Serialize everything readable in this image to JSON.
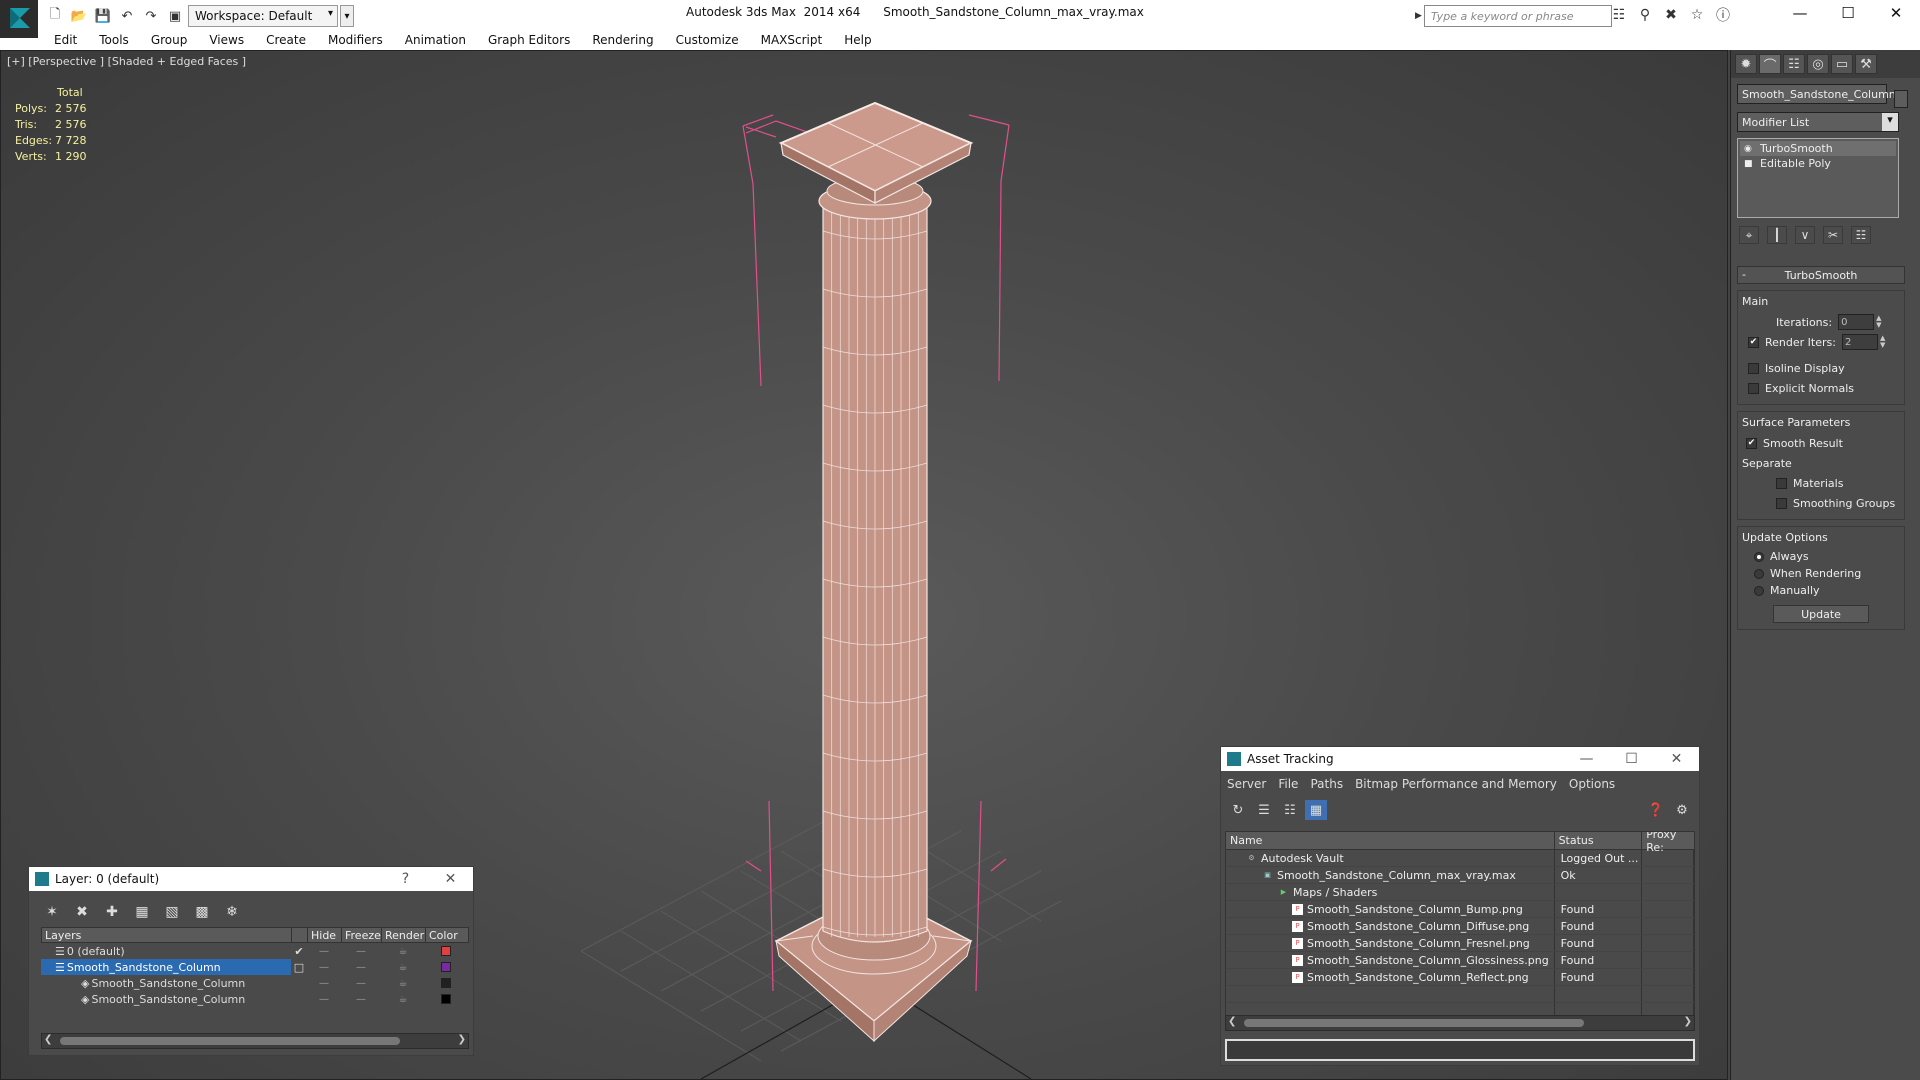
{
  "app": {
    "title": "Autodesk 3ds Max  2014 x64      Smooth_Sandstone_Column_max_vray.max",
    "workspace": "Workspace: Default",
    "search_placeholder": "Type a keyword or phrase"
  },
  "menu": [
    "Edit",
    "Tools",
    "Group",
    "Views",
    "Create",
    "Modifiers",
    "Animation",
    "Graph Editors",
    "Rendering",
    "Customize",
    "MAXScript",
    "Help"
  ],
  "viewport": {
    "label": "[+] [Perspective ] [Shaded + Edged Faces ]",
    "stats": {
      "total_label": "Total",
      "rows": [
        {
          "k": "Polys:",
          "v": "2 576"
        },
        {
          "k": "Tris:",
          "v": "2 576"
        },
        {
          "k": "Edges:",
          "v": "7 728"
        },
        {
          "k": "Verts:",
          "v": "1 290"
        }
      ]
    }
  },
  "command_panel": {
    "object_name": "Smooth_Sandstone_Column",
    "modifier_list": "Modifier List",
    "stack": [
      "TurboSmooth",
      "Editable Poly"
    ],
    "rollout": "TurboSmooth",
    "main_group": "Main",
    "iterations_label": "Iterations:",
    "iterations_value": "0",
    "render_iters_label": "Render Iters:",
    "render_iters_value": "2",
    "isoline": "Isoline Display",
    "explicit": "Explicit Normals",
    "surface_group": "Surface Parameters",
    "smooth_result": "Smooth Result",
    "separate": "Separate",
    "materials": "Materials",
    "smoothing_groups": "Smoothing Groups",
    "update_group": "Update Options",
    "always": "Always",
    "when_rendering": "When Rendering",
    "manually": "Manually",
    "update_btn": "Update"
  },
  "layer_window": {
    "title": "Layer: 0 (default)",
    "help": "?",
    "headers": [
      "Layers",
      "Hide",
      "Freeze",
      "Render",
      "Color"
    ],
    "rows": [
      {
        "name": "0 (default)",
        "color": "#e04040"
      },
      {
        "name": "Smooth_Sandstone_Column",
        "color": "#7a2aa0"
      },
      {
        "name": "Smooth_Sandstone_Column",
        "color": "#202020"
      },
      {
        "name": "Smooth_Sandstone_Column",
        "color": "#000000"
      }
    ]
  },
  "asset_window": {
    "title": "Asset Tracking",
    "menu": [
      "Server",
      "File",
      "Paths",
      "Bitmap Performance and Memory",
      "Options"
    ],
    "headers": [
      "Name",
      "Status",
      "Proxy Re:"
    ],
    "rows": [
      {
        "name": "Autodesk Vault",
        "status": "Logged Out ..."
      },
      {
        "name": "Smooth_Sandstone_Column_max_vray.max",
        "status": "Ok"
      },
      {
        "name": "Maps / Shaders",
        "status": ""
      },
      {
        "name": "Smooth_Sandstone_Column_Bump.png",
        "status": "Found"
      },
      {
        "name": "Smooth_Sandstone_Column_Diffuse.png",
        "status": "Found"
      },
      {
        "name": "Smooth_Sandstone_Column_Fresnel.png",
        "status": "Found"
      },
      {
        "name": "Smooth_Sandstone_Column_Glossiness.png",
        "status": "Found"
      },
      {
        "name": "Smooth_Sandstone_Column_Reflect.png",
        "status": "Found"
      }
    ]
  },
  "colors": {
    "column_fill": "#c49486",
    "wire": "#f2e6e2",
    "bbox": "#e0508a"
  }
}
